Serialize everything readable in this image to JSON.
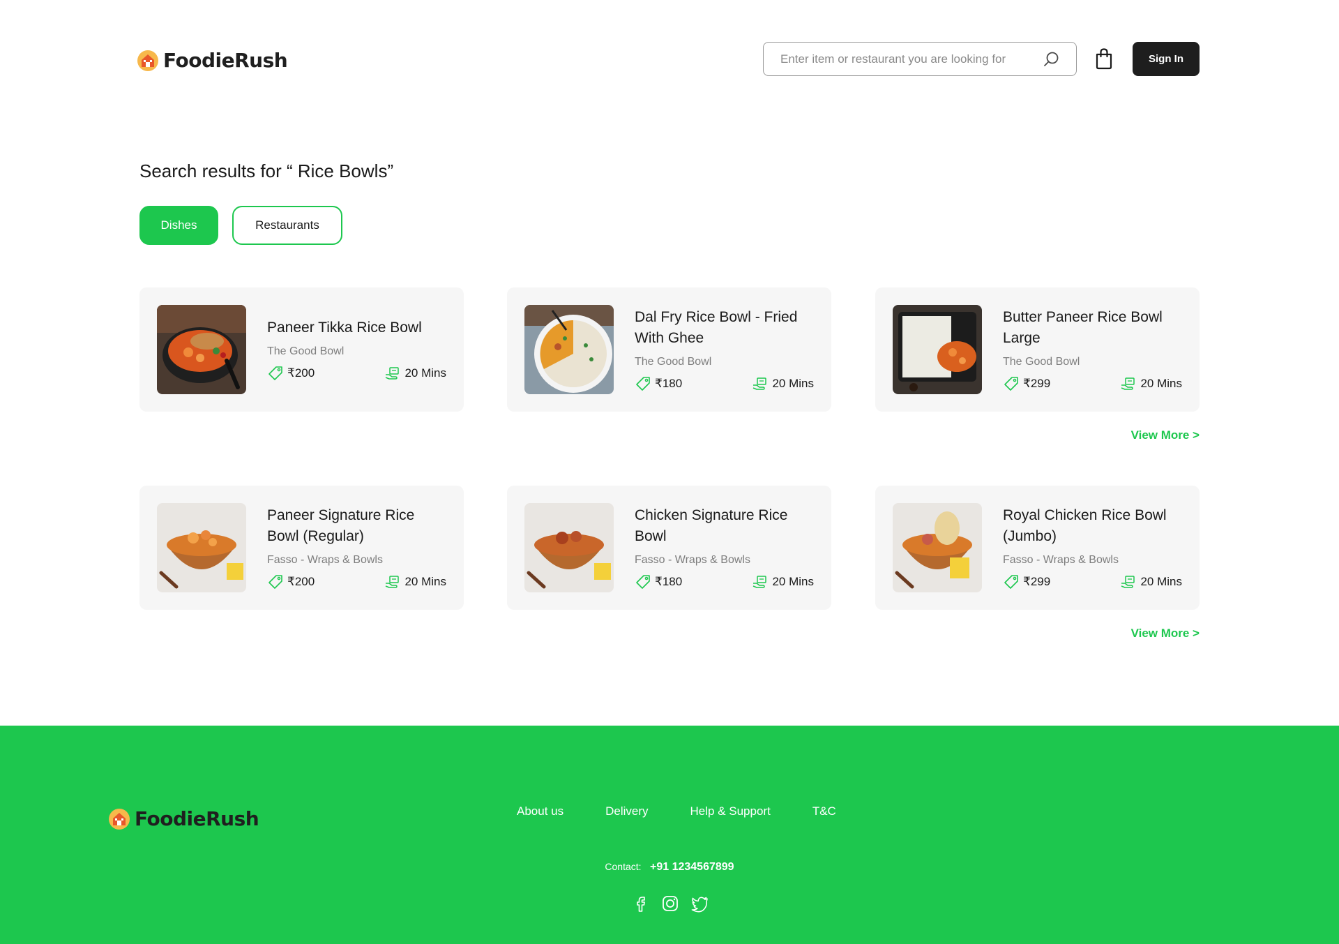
{
  "brand": {
    "name": "FoodieRush"
  },
  "header": {
    "search_placeholder": "Enter item or restaurant you are looking for",
    "sign_in_label": "Sign In"
  },
  "results": {
    "title": "Search results for “ Rice Bowls”",
    "tabs": [
      {
        "label": "Dishes",
        "active": true
      },
      {
        "label": "Restaurants",
        "active": false
      }
    ],
    "view_more_label": "View More >",
    "group_1": [
      {
        "name": "Paneer Tikka Rice Bowl",
        "restaurant": "The Good Bowl",
        "price": "₹200",
        "time": "20 Mins"
      },
      {
        "name": "Dal Fry Rice Bowl - Fried With Ghee",
        "restaurant": "The Good Bowl",
        "price": "₹180",
        "time": "20 Mins"
      },
      {
        "name": "Butter Paneer Rice Bowl Large",
        "restaurant": "The Good Bowl",
        "price": "₹299",
        "time": "20 Mins"
      }
    ],
    "group_2": [
      {
        "name": "Paneer Signature Rice Bowl (Regular)",
        "restaurant": "Fasso - Wraps & Bowls",
        "price": "₹200",
        "time": "20 Mins"
      },
      {
        "name": "Chicken Signature Rice Bowl",
        "restaurant": "Fasso - Wraps & Bowls",
        "price": "₹180",
        "time": "20 Mins"
      },
      {
        "name": "Royal Chicken Rice Bowl (Jumbo)",
        "restaurant": "Fasso - Wraps & Bowls",
        "price": "₹299",
        "time": "20 Mins"
      }
    ]
  },
  "footer": {
    "links": [
      "About us",
      "Delivery",
      "Help & Support",
      "T&C"
    ],
    "contact_label": "Contact:",
    "contact_phone": "+91 1234567899",
    "socials": [
      "facebook-icon",
      "instagram-icon",
      "twitter-icon"
    ]
  },
  "colors": {
    "accent": "#1dc74e",
    "dark": "#1e1e1e",
    "card_bg": "#f6f6f6"
  }
}
